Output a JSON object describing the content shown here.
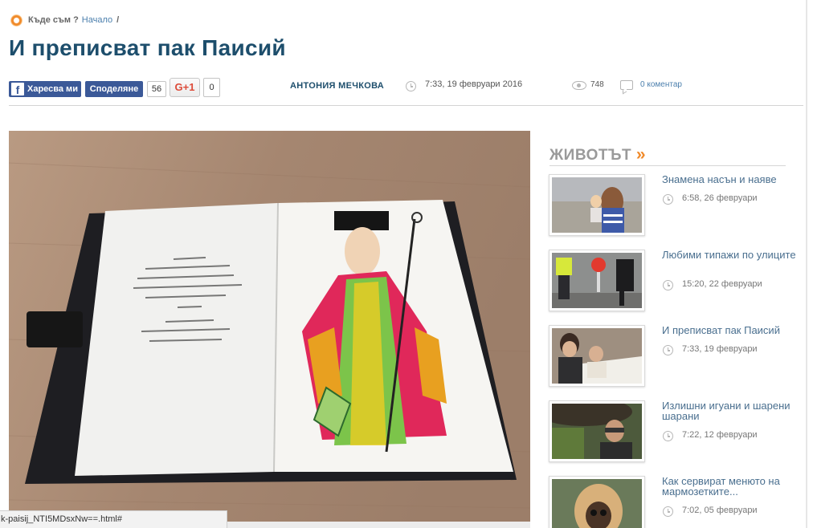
{
  "breadcrumb": {
    "where_label": "Къде съм ?",
    "home_link": "Начало",
    "separator": "/"
  },
  "article": {
    "title": "И преписват пак Паисий",
    "author": "АНТОНИЯ МЕЧКОВА",
    "datetime": "7:33, 19 февруари 2016",
    "views": "748",
    "comments_link": "0 коментар"
  },
  "social": {
    "fb_like_label": "Харесва ми",
    "fb_share_label": "Споделяне",
    "fb_count": "56",
    "gplus_label": "G+1",
    "gplus_count": "0"
  },
  "sidebar": {
    "section_title": "ЖИВОТЪТ",
    "section_arrows": "»",
    "items": [
      {
        "title": "Знамена насън и наяве",
        "date": "6:58, 26 февруари"
      },
      {
        "title": "Любими типажи по улиците",
        "date": "15:20, 22 февруари"
      },
      {
        "title": "И преписват пак Паисий",
        "date": "7:33, 19 февруари"
      },
      {
        "title": "Излишни игуани и шарени шарани",
        "date": "7:22, 12 февруари"
      },
      {
        "title": "Как сервират менюто на мармозетките...",
        "date": "7:02, 05 февруари"
      }
    ]
  },
  "statusbar": {
    "url": "k-paisij_NTI5MDsxNw==.html#"
  },
  "colors": {
    "title_blue": "#1d4e6c",
    "link_blue": "#4b7fad",
    "facebook": "#3b5998",
    "accent_orange": "#f08a2a"
  }
}
